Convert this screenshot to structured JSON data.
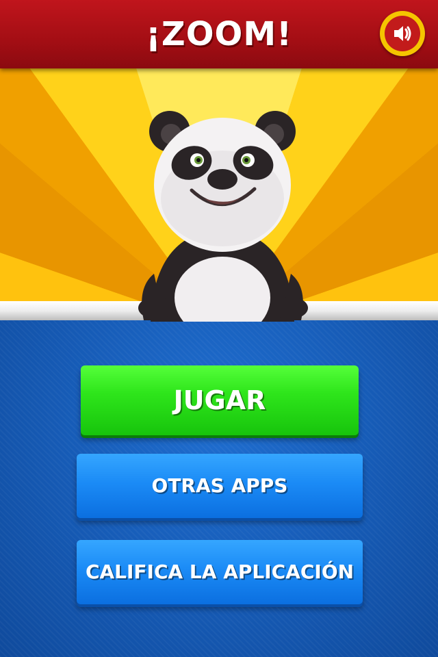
{
  "header": {
    "title": "¡ZOOM!",
    "sound_icon": "speaker-volume-icon"
  },
  "banner": {
    "character": "panda"
  },
  "menu": {
    "play_label": "JUGAR",
    "other_apps_label": "OTRAS APPS",
    "rate_label": "CALIFICA LA APLICACIÓN"
  },
  "colors": {
    "header_red": "#a30e14",
    "sound_ring_yellow": "#f5c500",
    "play_green": "#2ee51b",
    "button_blue": "#1b8bf6",
    "background_blue": "#175db9",
    "banner_yellow": "#ffd21a"
  }
}
